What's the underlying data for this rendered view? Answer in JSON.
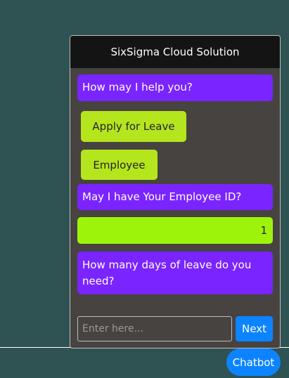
{
  "chat": {
    "title": "SixSigma Cloud Solution",
    "messages": [
      {
        "text": "How may I help you?"
      },
      {
        "text": "May I have Your Employee ID?"
      },
      {
        "text": "How many days of leave do you need?"
      }
    ],
    "options": [
      {
        "label": "Apply for Leave"
      },
      {
        "label": "Employee"
      }
    ],
    "user_reply": "1",
    "input": {
      "placeholder": "Enter here...",
      "value": ""
    },
    "next_label": "Next"
  },
  "launcher": {
    "label": "Chatbot"
  },
  "colors": {
    "page_bg": "#2f5252",
    "header_bg": "#141414",
    "panel_bg": "#474340",
    "bot_message": "#7a24ff",
    "option_button": "#b5e61d",
    "user_reply": "#9ef30a",
    "primary_button": "#0d84ff"
  }
}
